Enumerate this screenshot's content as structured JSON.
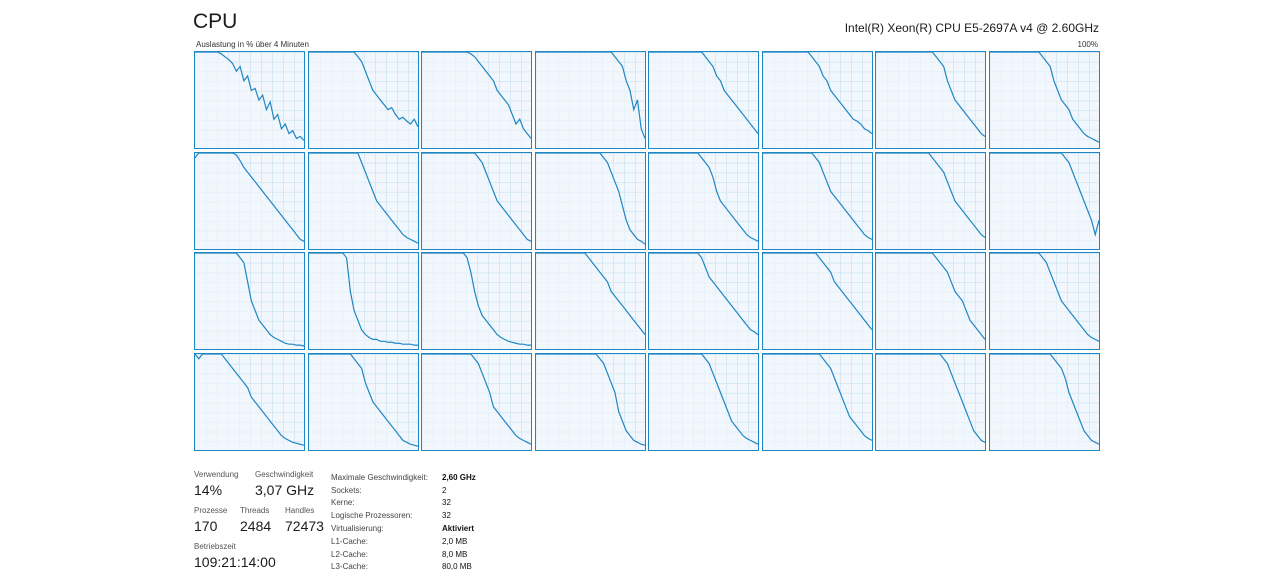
{
  "header": {
    "title": "CPU",
    "cpu_model": "Intel(R) Xeon(R) CPU E5-2697A v4 @ 2.60GHz",
    "axis_caption": "Auslastung in % über 4 Minuten",
    "axis_max": "100%"
  },
  "colors": {
    "line": "#1f86c4",
    "fill": "#f1f7fc",
    "grid": "#d7e8f4"
  },
  "stats": {
    "usage_label": "Verwendung",
    "usage_value": "14%",
    "speed_label": "Geschwindigkeit",
    "speed_value": "3,07 GHz",
    "processes_label": "Prozesse",
    "processes_value": "170",
    "threads_label": "Threads",
    "threads_value": "2484",
    "handles_label": "Handles",
    "handles_value": "72473",
    "uptime_label": "Betriebszeit",
    "uptime_value": "109:21:14:00"
  },
  "details": [
    {
      "key": "Maximale Geschwindigkeit:",
      "value": "2,60 GHz"
    },
    {
      "key": "Sockets:",
      "value": "2"
    },
    {
      "key": "Kerne:",
      "value": "32"
    },
    {
      "key": "Logische Prozessoren:",
      "value": "32"
    },
    {
      "key": "Virtualisierung:",
      "value": "Aktiviert"
    },
    {
      "key": "L1-Cache:",
      "value": "2,0 MB"
    },
    {
      "key": "L2-Cache:",
      "value": "8,0 MB"
    },
    {
      "key": "L3-Cache:",
      "value": "80,0 MB"
    }
  ],
  "chart_data": {
    "type": "line",
    "title": "Auslastung in % über 4 Minuten",
    "ylim": [
      0,
      100
    ],
    "series_count": 32,
    "series": [
      {
        "values": [
          100,
          100,
          100,
          100,
          100,
          100,
          100,
          98,
          95,
          92,
          88,
          80,
          85,
          70,
          75,
          60,
          62,
          50,
          55,
          40,
          48,
          30,
          35,
          20,
          25,
          15,
          18,
          10,
          12,
          8
        ]
      },
      {
        "values": [
          100,
          100,
          100,
          100,
          100,
          100,
          100,
          100,
          100,
          100,
          100,
          100,
          100,
          95,
          90,
          80,
          70,
          60,
          55,
          50,
          45,
          40,
          42,
          35,
          30,
          32,
          28,
          25,
          30,
          22
        ]
      },
      {
        "values": [
          100,
          100,
          100,
          100,
          100,
          100,
          100,
          100,
          100,
          100,
          100,
          100,
          100,
          98,
          95,
          90,
          85,
          80,
          75,
          70,
          60,
          55,
          50,
          45,
          35,
          25,
          30,
          20,
          15,
          10
        ]
      },
      {
        "values": [
          100,
          100,
          100,
          100,
          100,
          100,
          100,
          100,
          100,
          100,
          100,
          100,
          100,
          100,
          100,
          100,
          100,
          100,
          100,
          100,
          100,
          95,
          90,
          85,
          70,
          60,
          40,
          50,
          20,
          10
        ]
      },
      {
        "values": [
          100,
          100,
          100,
          100,
          100,
          100,
          100,
          100,
          100,
          100,
          100,
          100,
          100,
          100,
          100,
          95,
          90,
          85,
          75,
          70,
          60,
          55,
          50,
          45,
          40,
          35,
          30,
          25,
          20,
          15
        ]
      },
      {
        "values": [
          100,
          100,
          100,
          100,
          100,
          100,
          100,
          100,
          100,
          100,
          100,
          100,
          100,
          95,
          90,
          85,
          75,
          70,
          60,
          55,
          50,
          45,
          40,
          35,
          30,
          28,
          25,
          20,
          18,
          15
        ]
      },
      {
        "values": [
          100,
          100,
          100,
          100,
          100,
          100,
          100,
          100,
          100,
          100,
          100,
          100,
          100,
          100,
          100,
          100,
          95,
          90,
          85,
          70,
          60,
          50,
          45,
          40,
          35,
          30,
          25,
          20,
          15,
          12
        ]
      },
      {
        "values": [
          100,
          100,
          100,
          100,
          100,
          100,
          100,
          100,
          100,
          100,
          100,
          100,
          100,
          100,
          95,
          90,
          85,
          70,
          60,
          50,
          45,
          40,
          30,
          25,
          20,
          15,
          12,
          10,
          8,
          6
        ]
      },
      {
        "values": [
          95,
          100,
          100,
          100,
          100,
          100,
          100,
          100,
          100,
          100,
          100,
          98,
          92,
          85,
          80,
          75,
          70,
          65,
          60,
          55,
          50,
          45,
          40,
          35,
          30,
          25,
          20,
          15,
          10,
          8
        ]
      },
      {
        "values": [
          100,
          100,
          100,
          100,
          100,
          100,
          100,
          100,
          100,
          100,
          100,
          100,
          100,
          100,
          90,
          80,
          70,
          60,
          50,
          45,
          40,
          35,
          30,
          25,
          20,
          15,
          12,
          10,
          8,
          6
        ]
      },
      {
        "values": [
          100,
          100,
          100,
          100,
          100,
          100,
          100,
          100,
          100,
          100,
          100,
          100,
          100,
          100,
          100,
          95,
          90,
          80,
          70,
          60,
          50,
          45,
          40,
          35,
          30,
          25,
          20,
          15,
          10,
          8
        ]
      },
      {
        "values": [
          100,
          100,
          100,
          100,
          100,
          100,
          100,
          100,
          100,
          100,
          100,
          100,
          100,
          100,
          100,
          100,
          100,
          100,
          95,
          90,
          80,
          70,
          60,
          45,
          30,
          20,
          15,
          10,
          8,
          5
        ]
      },
      {
        "values": [
          100,
          100,
          100,
          100,
          100,
          100,
          100,
          100,
          100,
          100,
          100,
          100,
          100,
          100,
          95,
          90,
          85,
          75,
          60,
          50,
          45,
          40,
          35,
          30,
          25,
          20,
          15,
          12,
          10,
          8
        ]
      },
      {
        "values": [
          100,
          100,
          100,
          100,
          100,
          100,
          100,
          100,
          100,
          100,
          100,
          100,
          100,
          100,
          95,
          90,
          80,
          70,
          60,
          55,
          50,
          45,
          40,
          35,
          30,
          25,
          20,
          15,
          12,
          10
        ]
      },
      {
        "values": [
          100,
          100,
          100,
          100,
          100,
          100,
          100,
          100,
          100,
          100,
          100,
          100,
          100,
          100,
          100,
          95,
          90,
          85,
          80,
          70,
          60,
          50,
          45,
          40,
          35,
          30,
          25,
          20,
          15,
          12
        ]
      },
      {
        "values": [
          100,
          100,
          100,
          100,
          100,
          100,
          100,
          100,
          100,
          100,
          100,
          100,
          100,
          100,
          100,
          100,
          100,
          100,
          100,
          100,
          95,
          90,
          80,
          70,
          60,
          50,
          40,
          30,
          15,
          30
        ]
      },
      {
        "values": [
          100,
          100,
          100,
          100,
          100,
          100,
          100,
          100,
          100,
          100,
          100,
          100,
          95,
          90,
          70,
          50,
          40,
          30,
          25,
          20,
          15,
          12,
          10,
          8,
          6,
          5,
          5,
          4,
          4,
          3
        ]
      },
      {
        "values": [
          100,
          100,
          100,
          100,
          100,
          100,
          100,
          100,
          100,
          100,
          95,
          60,
          40,
          30,
          20,
          15,
          12,
          10,
          10,
          8,
          8,
          7,
          7,
          6,
          6,
          5,
          5,
          5,
          4,
          4
        ]
      },
      {
        "values": [
          100,
          100,
          100,
          100,
          100,
          100,
          100,
          100,
          100,
          100,
          100,
          100,
          95,
          80,
          60,
          45,
          35,
          30,
          25,
          20,
          15,
          12,
          10,
          8,
          7,
          6,
          5,
          5,
          4,
          4
        ]
      },
      {
        "values": [
          100,
          100,
          100,
          100,
          100,
          100,
          100,
          100,
          100,
          100,
          100,
          100,
          100,
          100,
          95,
          90,
          85,
          80,
          75,
          70,
          60,
          55,
          50,
          45,
          40,
          35,
          30,
          25,
          20,
          15
        ]
      },
      {
        "values": [
          100,
          100,
          100,
          100,
          100,
          100,
          100,
          100,
          100,
          100,
          100,
          100,
          100,
          100,
          95,
          85,
          75,
          70,
          65,
          60,
          55,
          50,
          45,
          40,
          35,
          30,
          25,
          20,
          18,
          15
        ]
      },
      {
        "values": [
          100,
          100,
          100,
          100,
          100,
          100,
          100,
          100,
          100,
          100,
          100,
          100,
          100,
          100,
          100,
          95,
          90,
          85,
          80,
          70,
          65,
          60,
          55,
          50,
          45,
          40,
          35,
          30,
          25,
          20
        ]
      },
      {
        "values": [
          100,
          100,
          100,
          100,
          100,
          100,
          100,
          100,
          100,
          100,
          100,
          100,
          100,
          100,
          100,
          100,
          95,
          90,
          85,
          80,
          70,
          60,
          55,
          50,
          40,
          30,
          25,
          20,
          15,
          10
        ]
      },
      {
        "values": [
          100,
          100,
          100,
          100,
          100,
          100,
          100,
          100,
          100,
          100,
          100,
          100,
          100,
          100,
          95,
          90,
          80,
          70,
          60,
          50,
          45,
          40,
          35,
          30,
          25,
          20,
          15,
          12,
          10,
          8
        ]
      },
      {
        "values": [
          100,
          95,
          100,
          100,
          100,
          100,
          100,
          100,
          95,
          90,
          85,
          80,
          75,
          70,
          65,
          55,
          50,
          45,
          40,
          35,
          30,
          25,
          20,
          15,
          12,
          10,
          8,
          7,
          6,
          5
        ]
      },
      {
        "values": [
          100,
          100,
          100,
          100,
          100,
          100,
          100,
          100,
          100,
          100,
          100,
          100,
          95,
          90,
          85,
          70,
          60,
          50,
          45,
          40,
          35,
          30,
          25,
          20,
          15,
          10,
          8,
          6,
          5,
          4
        ]
      },
      {
        "values": [
          100,
          100,
          100,
          100,
          100,
          100,
          100,
          100,
          100,
          100,
          100,
          100,
          100,
          100,
          95,
          90,
          80,
          70,
          60,
          45,
          40,
          35,
          30,
          25,
          20,
          15,
          12,
          10,
          8,
          6
        ]
      },
      {
        "values": [
          100,
          100,
          100,
          100,
          100,
          100,
          100,
          100,
          100,
          100,
          100,
          100,
          100,
          100,
          100,
          100,
          100,
          95,
          90,
          80,
          70,
          60,
          40,
          30,
          20,
          15,
          10,
          8,
          6,
          5
        ]
      },
      {
        "values": [
          100,
          100,
          100,
          100,
          100,
          100,
          100,
          100,
          100,
          100,
          100,
          100,
          100,
          100,
          100,
          95,
          90,
          80,
          70,
          60,
          50,
          40,
          30,
          25,
          20,
          15,
          12,
          10,
          8,
          6
        ]
      },
      {
        "values": [
          100,
          100,
          100,
          100,
          100,
          100,
          100,
          100,
          100,
          100,
          100,
          100,
          100,
          100,
          100,
          100,
          95,
          90,
          85,
          75,
          65,
          55,
          45,
          35,
          30,
          25,
          20,
          15,
          12,
          10
        ]
      },
      {
        "values": [
          100,
          100,
          100,
          100,
          100,
          100,
          100,
          100,
          100,
          100,
          100,
          100,
          100,
          100,
          100,
          100,
          100,
          100,
          95,
          90,
          80,
          70,
          60,
          50,
          40,
          30,
          20,
          15,
          10,
          8
        ]
      },
      {
        "values": [
          100,
          100,
          100,
          100,
          100,
          100,
          100,
          100,
          100,
          100,
          100,
          100,
          100,
          100,
          100,
          100,
          100,
          95,
          90,
          85,
          75,
          60,
          50,
          40,
          30,
          20,
          15,
          10,
          8,
          6
        ]
      }
    ]
  }
}
